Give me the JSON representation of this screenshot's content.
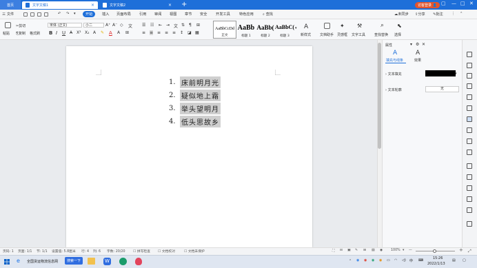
{
  "titlebar": {
    "home_tab": "首页",
    "tabs": [
      {
        "label": "文字文稿1",
        "active": true
      },
      {
        "label": "文字文稿2",
        "active": false
      }
    ],
    "login_label": "访客登录",
    "colors": {
      "bar": "#1e6fd9",
      "login": "#e4542c"
    }
  },
  "menubar": {
    "file_label": "三 文件",
    "items": [
      "开始",
      "插入",
      "页面布局",
      "引用",
      "审阅",
      "视图",
      "章节",
      "安全",
      "开发工具",
      "特色应用"
    ],
    "active_item": "开始",
    "search_label": "查找",
    "sync_label": "未同步",
    "share_label": "分享",
    "comment_label": "批注"
  },
  "ribbon": {
    "paste_label": "粘贴",
    "cut_label": "剪切",
    "copy_label": "复制",
    "format_painter_label": "格式刷",
    "font_name": "宋体 (正文)",
    "font_size": "小二",
    "styles": [
      {
        "preview": "AaBbCcDd",
        "label": "正文"
      },
      {
        "preview": "AaBb",
        "label": "标题 1"
      },
      {
        "preview": "AaBb(",
        "label": "标题 2"
      },
      {
        "preview": "AaBbC(",
        "label": "标题 3"
      }
    ],
    "new_style_label": "新样式",
    "doc_assistant_label": "文档助手",
    "inspiration_label": "灵感框",
    "text_tools_label": "文字工具",
    "find_replace_label": "查找替换",
    "select_label": "选择"
  },
  "document": {
    "list": [
      {
        "num": "1.",
        "text": "床前明月光"
      },
      {
        "num": "2.",
        "text": "疑似地上霜"
      },
      {
        "num": "3.",
        "text": "举头望明月"
      },
      {
        "num": "4.",
        "text": "低头思故乡"
      }
    ]
  },
  "panel": {
    "title": "属性",
    "tabs": [
      "填充与线条",
      "效果"
    ],
    "text_fill_label": "文本填充",
    "text_outline_label": "文本轮廓",
    "text_outline_value": "无",
    "fill_color": "#000000"
  },
  "statusbar": {
    "page_num": "页码: 1",
    "pages": "页面: 1/1",
    "section": "节: 1/1",
    "setting": "设置值: 5.8厘米",
    "row": "行: 4",
    "col": "列: 6",
    "words": "字数: 20/20",
    "spell": "拼写检查",
    "proof": "文档校对",
    "unprotected": "文档未保护",
    "zoom": "100%"
  },
  "taskbar": {
    "search_app": "全国货运物流信息网",
    "search_button": "搜索一下",
    "time": "15:26",
    "date": "2022/1/13",
    "ime": "中"
  }
}
